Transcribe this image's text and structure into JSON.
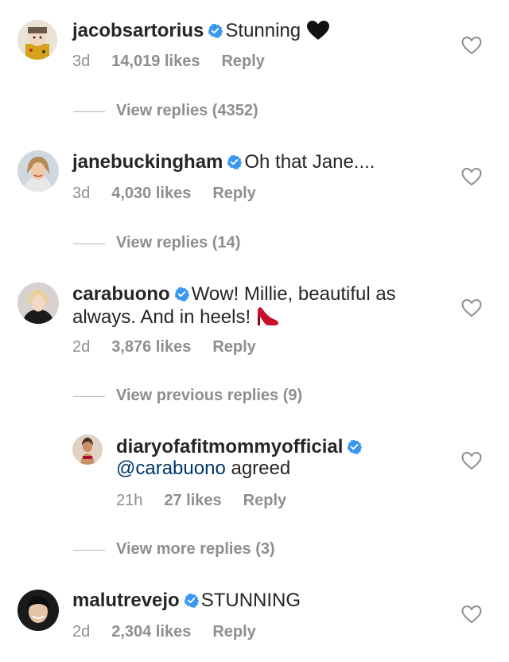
{
  "comments": [
    {
      "username": "jacobsartorius",
      "verified": true,
      "text": "Stunning",
      "emoji": "black-heart-emoji",
      "time": "3d",
      "likes": "14,019 likes",
      "reply": "Reply",
      "view_replies": "View replies (4352)"
    },
    {
      "username": "janebuckingham",
      "verified": true,
      "text": "Oh that Jane....",
      "time": "3d",
      "likes": "4,030 likes",
      "reply": "Reply",
      "view_replies": "View replies (14)"
    },
    {
      "username": "carabuono",
      "verified": true,
      "text_line1": "Wow! Millie, beautiful as",
      "text_line2": "always. And in heels!",
      "emoji": "high-heel-shoe-emoji",
      "time": "2d",
      "likes": "3,876 likes",
      "reply": "Reply",
      "view_previous_replies": "View previous replies (9)",
      "replies": [
        {
          "username": "diaryofafitmommyofficial",
          "verified": true,
          "mention": "@carabuono",
          "text": " agreed",
          "time": "21h",
          "likes": "27 likes",
          "reply": "Reply"
        }
      ],
      "view_more_replies": "View more replies (3)"
    },
    {
      "username": "malutrevejo",
      "verified": true,
      "text": "STUNNING",
      "time": "2d",
      "likes": "2,304 likes",
      "reply": "Reply"
    }
  ],
  "colors": {
    "text": "#262626",
    "muted": "#8e8e8e",
    "verified_blue": "#3897f0",
    "mention": "#003569"
  },
  "icons": {
    "like": "heart-outline-icon",
    "verified": "verified-badge-icon"
  }
}
